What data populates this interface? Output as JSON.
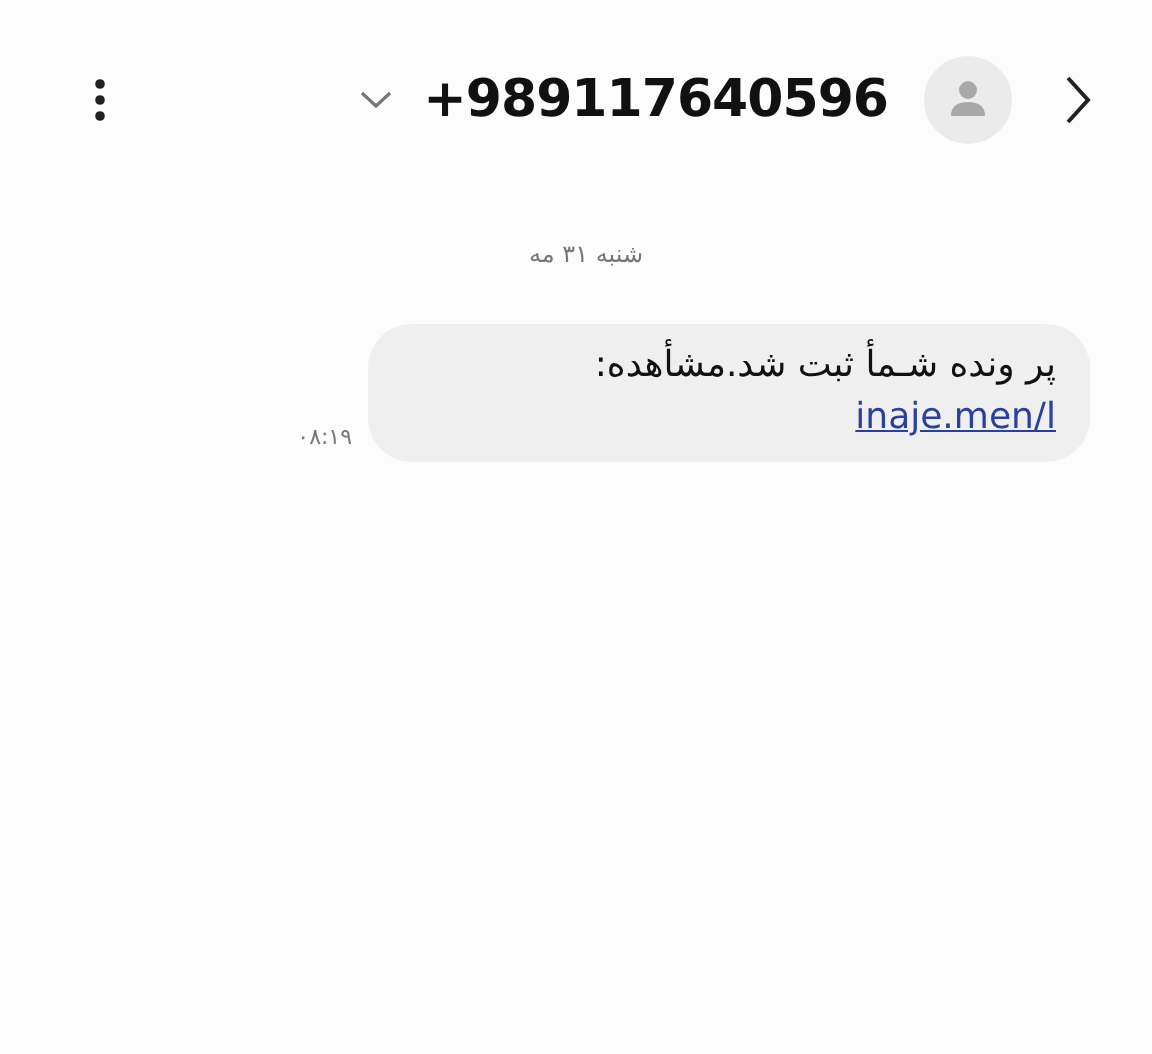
{
  "header": {
    "title": "+989117640596"
  },
  "date_separator": "شنبه ۳۱ مه",
  "messages": [
    {
      "text": "پر ونده شـمأ ثبت شد.مشأهده:",
      "link": "inaje.men/l",
      "time": "۰۸:۱۹"
    }
  ]
}
